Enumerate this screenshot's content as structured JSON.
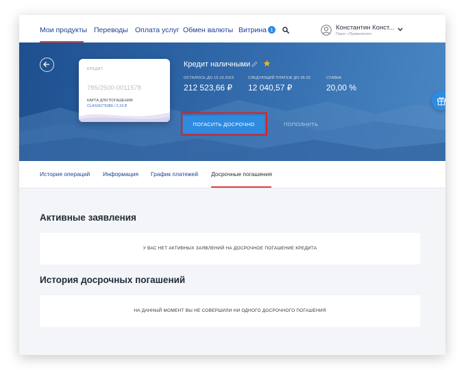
{
  "nav": {
    "items": [
      {
        "label": "Мои продукты"
      },
      {
        "label": "Переводы"
      },
      {
        "label": "Оплата услуг"
      },
      {
        "label": "Обмен валюты"
      },
      {
        "label": "Витрина",
        "badge": "1"
      }
    ]
  },
  "user": {
    "name": "Константин Конст...",
    "package": "Пакет «Привилегия»"
  },
  "card": {
    "type": "КРЕДИТ",
    "number": "785/2500-0011578",
    "repay_label": "КАРТА ДЛЯ ПОГАШЕНИЯ",
    "repay_value": "CLASSIC*6380 / 2,19 ₽"
  },
  "loan": {
    "title": "Кредит наличными",
    "stats": [
      {
        "label": "ОСТАЛОСЬ ДО 15.10.2019",
        "value": "212 523,66 ₽"
      },
      {
        "label": "СЛЕДУЮЩИЙ ПЛАТЕЖ ДО 05.02",
        "value": "12 040,57 ₽"
      },
      {
        "label": "СТАВКА",
        "value": "20,00 %"
      }
    ],
    "repay_button": "ПОГАСИТЬ ДОСРОЧНО",
    "topup_button": "ПОПОЛНИТЬ"
  },
  "tabs": [
    {
      "label": "История операций"
    },
    {
      "label": "Информация"
    },
    {
      "label": "График платежей"
    },
    {
      "label": "Досрочные погашения",
      "active": true
    }
  ],
  "sections": {
    "active": {
      "title": "Активные заявления",
      "empty_text": "У ВАС НЕТ АКТИВНЫХ ЗАЯВЛЕНИЙ НА ДОСРОЧНОЕ ПОГАШЕНИЕ КРЕДИТА"
    },
    "history": {
      "title": "История досрочных погашений",
      "empty_text": "НА ДАННЫЙ МОМЕНТ ВЫ НЕ СОВЕРШИЛИ НИ ОДНОГО ДОСРОЧНОГО ПОГАШЕНИЯ"
    }
  },
  "icons": {
    "back": "arrow-left-icon",
    "search": "search-icon",
    "user": "user-avatar-icon",
    "chevron": "chevron-down-icon",
    "edit": "pencil-icon",
    "favorite": "star-icon",
    "gift": "gift-icon"
  },
  "colors": {
    "accent": "#2f8be0",
    "nav_link": "#1b3f8f",
    "active_underline": "#e63a3a",
    "favorite_star": "#f2b51a"
  }
}
